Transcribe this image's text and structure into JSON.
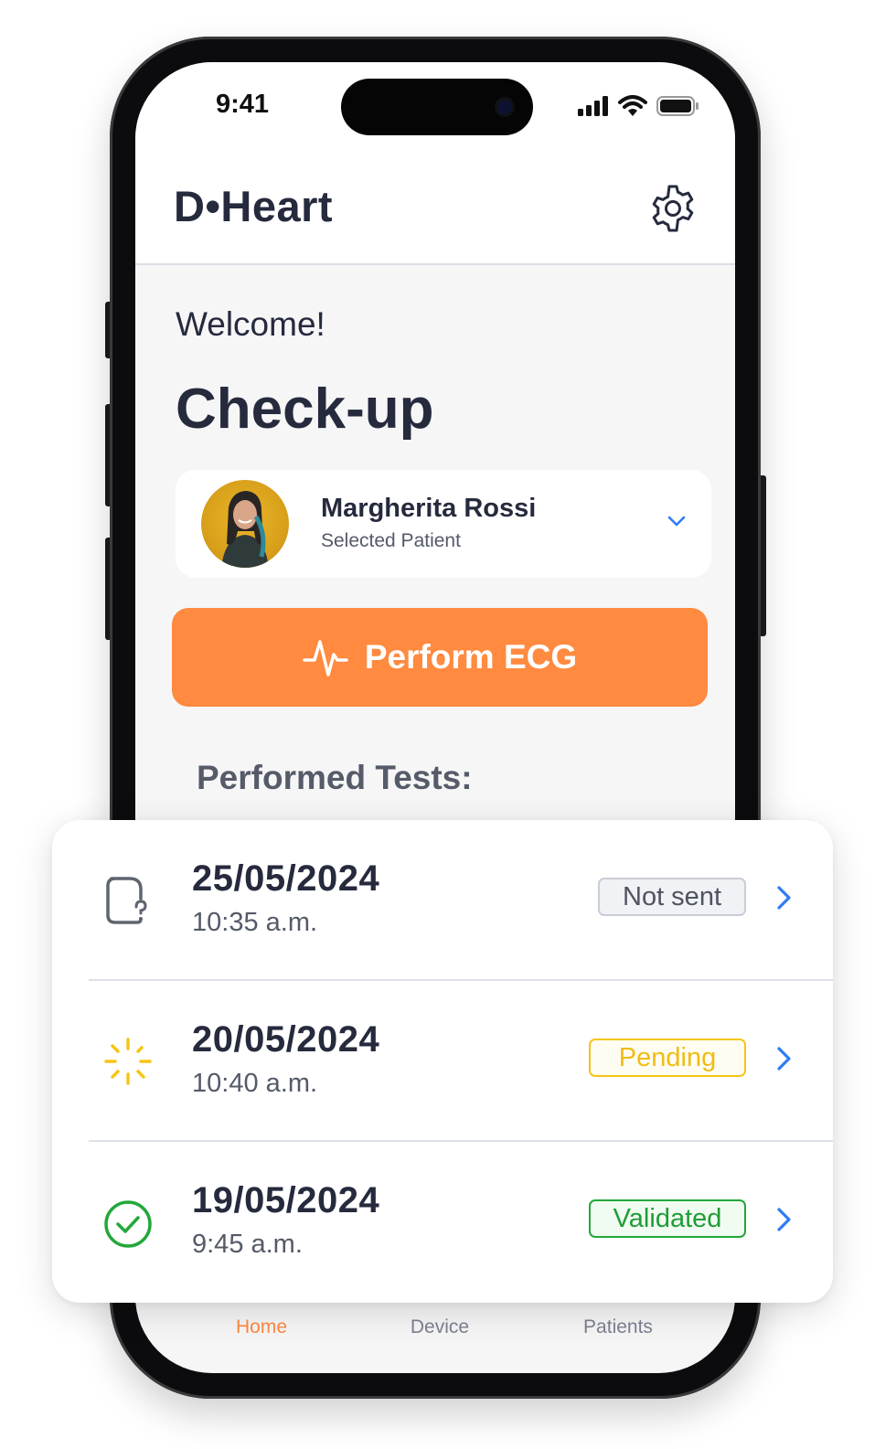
{
  "status_bar": {
    "time": "9:41"
  },
  "app": {
    "brand": "D•Heart"
  },
  "home": {
    "welcome": "Welcome!",
    "title": "Check-up",
    "patient": {
      "name": "Margherita Rossi",
      "subtitle": "Selected Patient"
    },
    "perform_button": "Perform ECG",
    "performed_label": "Performed Tests:"
  },
  "tests": [
    {
      "date": "25/05/2024",
      "time": "10:35 a.m.",
      "status": "Not sent",
      "icon": "unknown-document-icon"
    },
    {
      "date": "20/05/2024",
      "time": "10:40 a.m.",
      "status": "Pending",
      "icon": "loading-spinner-icon"
    },
    {
      "date": "19/05/2024",
      "time": "9:45 a.m.",
      "status": "Validated",
      "icon": "check-circle-icon"
    }
  ],
  "status_colors": {
    "not_sent": "#8a8f9c",
    "pending": "#f5c518",
    "validated": "#23a83a"
  },
  "accent_color": "#ff8a40",
  "chevron_color": "#2f7bf5",
  "tabs": [
    {
      "label": "Home",
      "active": true
    },
    {
      "label": "Device",
      "active": false
    },
    {
      "label": "Patients",
      "active": false
    }
  ]
}
